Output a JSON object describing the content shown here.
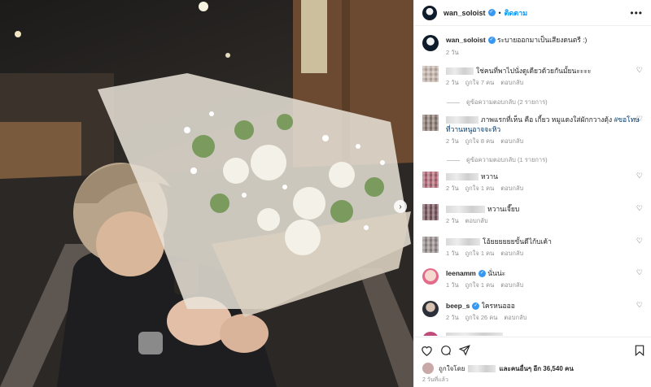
{
  "post": {
    "username": "wan_soloist",
    "follow_label": "ติดตาม",
    "caption": "ระบายออกมาเป็นเสียงดนตรี :)",
    "caption_time": "2 วัน"
  },
  "comments": [
    {
      "user": "",
      "text": "ใช่คนที่พาไปนั่งดูเดียวด้วยกันมั้ยนะะะะ",
      "time": "2 วัน",
      "likes": "ถูกใจ 7 คน",
      "reply": "ตอบกลับ",
      "avatar_color": "#c8b9b0"
    },
    {
      "user": "",
      "text": "ภาพแรกที่เห็น คือ เกี้ยว หมูแดงใส่ผักกวางตุ้ง",
      "hashtag": "#ขอโทษที่วานหนูอาจจะหิว",
      "time": "2 วัน",
      "likes": "ถูกใจ 8 คน",
      "reply": "ตอบกลับ",
      "avatar_color": "#8d7f77"
    },
    {
      "user": "",
      "text": "หวาน",
      "time": "2 วัน",
      "likes": "ถูกใจ 1 คน",
      "reply": "ตอบกลับ",
      "avatar_color": "#b06d7a"
    },
    {
      "user": "",
      "text": "หวานเจี๊ยบ",
      "time": "2 วัน",
      "likes": "",
      "reply": "ตอบกลับ",
      "avatar_color": "#7a5a62"
    },
    {
      "user": "",
      "text": "โอ้ยยยยยยขั้นดีไก้บเค้า",
      "time": "1 วัน",
      "likes": "ถูกใจ 1 คน",
      "reply": "ตอบกลับ",
      "avatar_color": "#9a9090"
    },
    {
      "user": "leenamm",
      "text": "นั่นน่ะ",
      "time": "1 วัน",
      "likes": "ถูกใจ 1 คน",
      "reply": "ตอบกลับ",
      "avatar_color": "#e8c8c0"
    },
    {
      "user": "beep_s",
      "text": "ใครหนอออ",
      "time": "2 วัน",
      "likes": "ถูกใจ 26 คน",
      "reply": "ตอบกลับ",
      "avatar_color": "#2a2f3a"
    }
  ],
  "reply_threads": [
    {
      "label": "ดูข้อความตอบกลับ (2 รายการ)"
    },
    {
      "label": "ดูข้อความตอบกลับ (1 รายการ)"
    }
  ],
  "likes": {
    "prefix": "ถูกใจโดย",
    "suffix": "และคนอื่นๆ อีก 36,540 คน"
  },
  "time_ago": "2 วันที่แล้ว",
  "icons": {
    "verified": "verified-icon",
    "more": "more-options-icon",
    "heart": "heart-icon",
    "comment": "comment-icon",
    "share": "share-icon",
    "bookmark": "bookmark-icon",
    "next": "chevron-right-icon"
  },
  "colors": {
    "link": "#0095f6",
    "muted": "#8e8e8e",
    "verified": "#3897f0"
  }
}
